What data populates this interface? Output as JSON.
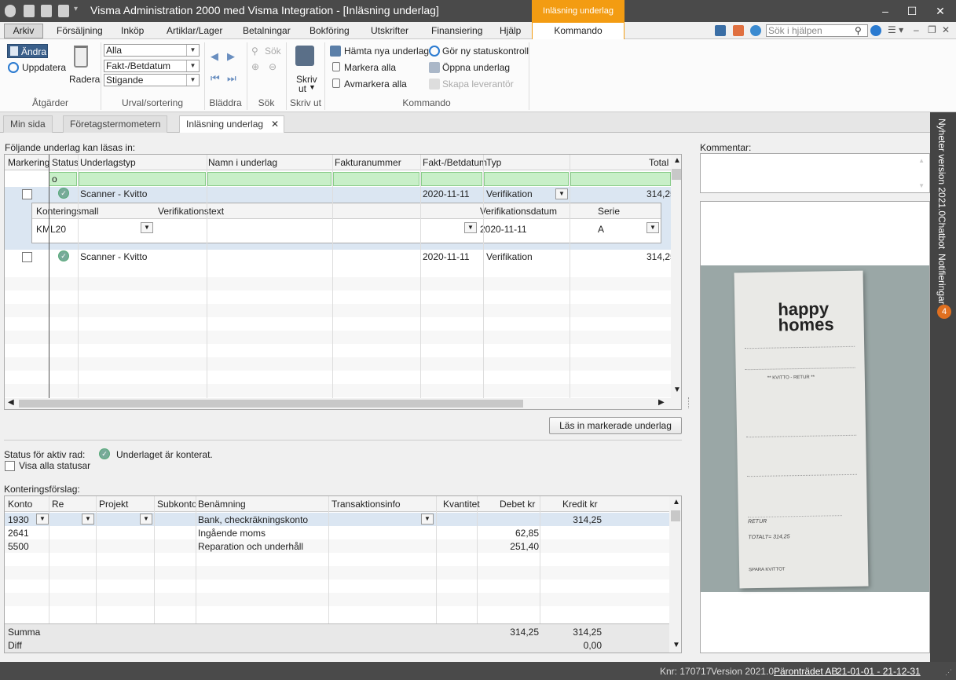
{
  "window": {
    "title": "Visma Administration 2000 med Visma Integration - [Inläsning underlag]",
    "context_tab": "Inläsning underlag"
  },
  "menu": {
    "items": [
      "Arkiv",
      "Försäljning",
      "Inköp",
      "Artiklar/Lager",
      "Betalningar",
      "Bokföring",
      "Utskrifter",
      "Finansiering",
      "Hjälp",
      "Kommando"
    ],
    "help_placeholder": "Sök i hjälpen"
  },
  "ribbon": {
    "andra": "Ändra",
    "uppdatera": "Uppdatera",
    "radera": "Radera",
    "group_atgarder": "Åtgärder",
    "filter1": "Alla",
    "filter2": "Fakt-/Betdatum",
    "filter3": "Stigande",
    "group_urval": "Urval/sortering",
    "group_bladdra": "Bläddra",
    "sok": "Sök",
    "group_sok": "Sök",
    "skrivut": "Skriv",
    "skrivut2": "ut",
    "group_skrivut": "Skriv ut",
    "hamta": "Hämta nya underlag",
    "markera": "Markera alla",
    "avmarkera": "Avmarkera alla",
    "statuskontroll": "Gör ny statuskontroll",
    "oppna": "Öppna underlag",
    "skapa": "Skapa leverantör",
    "group_kommando": "Kommando"
  },
  "tabs": [
    "Min sida",
    "Företagstermometern",
    "Inläsning underlag"
  ],
  "sidebar": {
    "nyheter": "Nyheter version 2021.0",
    "chatbot": "Chatbot",
    "notifieringar": "Notifieringar",
    "badge": "4"
  },
  "upper": {
    "caption": "Följande underlag kan läsas in:",
    "columns": [
      "Markering",
      "Status",
      "Underlagstyp",
      "Namn i underlag",
      "Fakturanummer",
      "Fakt-/Betdatum",
      "Typ",
      "Total"
    ],
    "filter_status": "o",
    "rows": [
      {
        "typ": "Scanner - Kvitto",
        "datum": "2020-11-11",
        "vtyp": "Verifikation",
        "total": "314,25"
      },
      {
        "typ": "Scanner - Kvitto",
        "datum": "2020-11-11",
        "vtyp": "Verifikation",
        "total": "314,25"
      }
    ],
    "sub": {
      "columns": [
        "Konteringsmall",
        "Verifikationstext",
        "Verifikationsdatum",
        "Serie"
      ],
      "mall": "KML20",
      "text": "",
      "datum": "2020-11-11",
      "serie": "A"
    },
    "read_button": "Läs in markerade underlag"
  },
  "status": {
    "label": "Status för aktiv rad:",
    "text": "Underlaget är konterat.",
    "visa": "Visa alla statusar"
  },
  "kontering": {
    "caption": "Konteringsförslag:",
    "columns": [
      "Konto",
      "Re",
      "Projekt",
      "Subkonto",
      "Benämning",
      "Transaktionsinfo",
      "Kvantitet",
      "Debet kr",
      "Kredit kr"
    ],
    "rows": [
      {
        "konto": "1930",
        "ben": "Bank, checkräkningskonto",
        "debet": "",
        "kredit": "314,25"
      },
      {
        "konto": "2641",
        "ben": "Ingående moms",
        "debet": "62,85",
        "kredit": ""
      },
      {
        "konto": "5500",
        "ben": "Reparation och underhåll",
        "debet": "251,40",
        "kredit": ""
      }
    ],
    "summa_label": "Summa",
    "summa_debet": "314,25",
    "summa_kredit": "314,25",
    "diff_label": "Diff",
    "diff": "0,00"
  },
  "kommentar": {
    "label": "Kommentar:"
  },
  "receipt": {
    "brand1": "happy",
    "brand2": "homes",
    "heading": "** KVITTO - RETUR **",
    "retur": "RETUR",
    "total_line": "TOTALT=   314,25",
    "spara": "SPARA KVITTOT"
  },
  "statusbar": {
    "knr": "Knr: 170717",
    "version": "Version 2021.0",
    "company": "Päronträdet AB",
    "period": "21-01-01 - 21-12-31"
  }
}
